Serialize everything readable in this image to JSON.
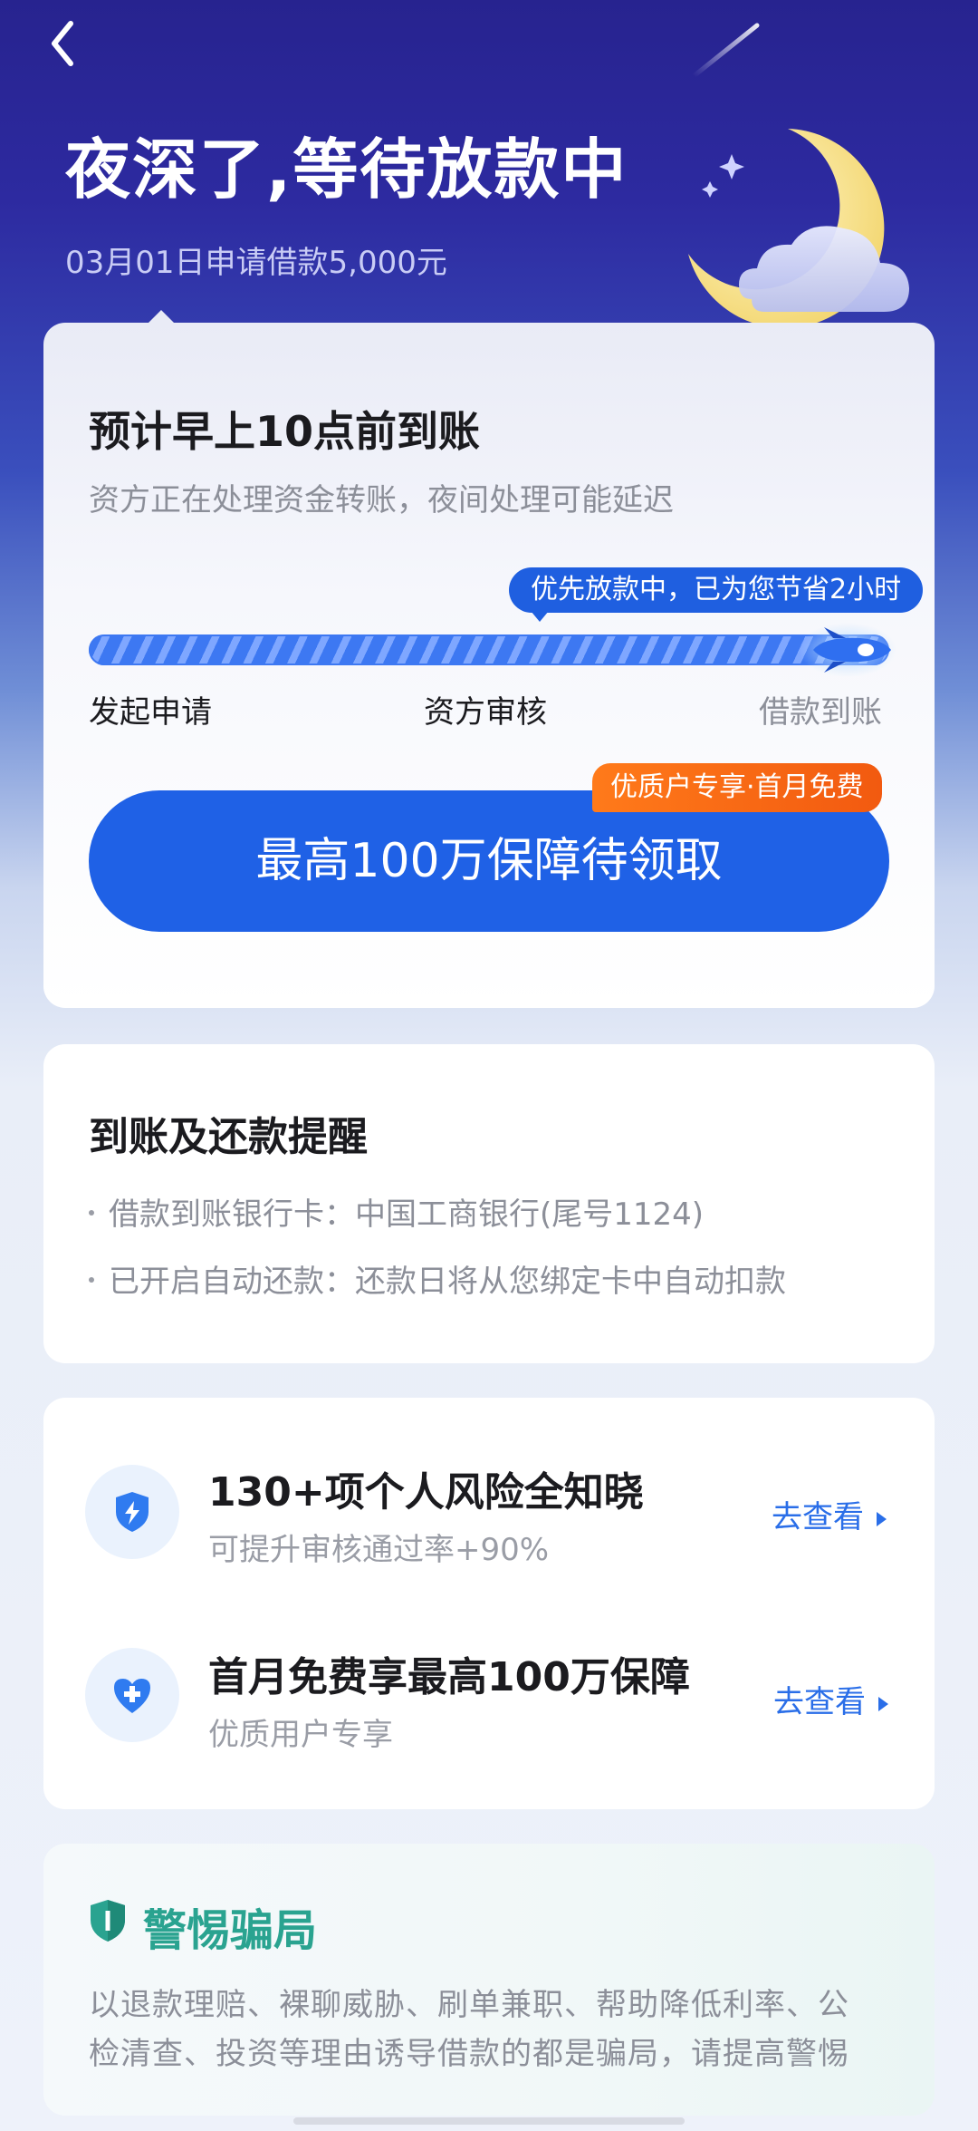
{
  "header": {
    "title": "夜深了,等待放款中",
    "subtitle": "03月01日申请借款5,000元"
  },
  "status_card": {
    "heading": "预计早上10点前到账",
    "description": "资方正在处理资金转账，夜间处理可能延迟",
    "progress_tip": "优先放款中，已为您节省2小时",
    "progress_fraction": 0.95,
    "steps": [
      "发起申请",
      "资方审核",
      "借款到账"
    ],
    "cta_label": "最高100万保障待领取",
    "cta_badge": "优质户专享·首月免费"
  },
  "reminder_card": {
    "heading": "到账及还款提醒",
    "items": [
      "借款到账银行卡：中国工商银行(尾号1124)",
      "已开启自动还款：还款日将从您绑定卡中自动扣款"
    ]
  },
  "services": [
    {
      "icon": "lightning-shield-icon",
      "title": "130+项个人风险全知晓",
      "subtitle": "可提升审核通过率+90%",
      "link": "去查看"
    },
    {
      "icon": "heart-plus-icon",
      "title": "首月免费享最高100万保障",
      "subtitle": "优质用户专享",
      "link": "去查看"
    }
  ],
  "fraud_warning": {
    "title": "警惕骗局",
    "lines": [
      "以退款理赔、裸聊威胁、刷单兼职、帮助降低利率、公",
      "检清查、投资等理由诱导借款的都是骗局，请提高警惕"
    ]
  },
  "colors": {
    "primary": "#1f61e6",
    "badge_orange": "#f25a10",
    "warning_green": "#2aa390",
    "night_blue": "#27238f"
  }
}
